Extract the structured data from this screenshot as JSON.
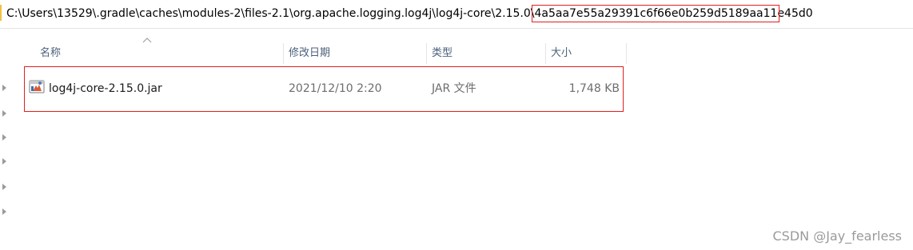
{
  "address_bar": {
    "path_prefix": "C:\\Users\\13529\\.gradle\\caches\\modules-2\\files-2.1\\org.apache.logging.log4j\\log4j-core\\2.15.0\\",
    "path_hash_highlighted": "4a5aa7e55a29391c6f66e0b259d5189aa11",
    "path_hash_rest": "e45d0"
  },
  "columns": {
    "name": "名称",
    "modified": "修改日期",
    "type": "类型",
    "size": "大小"
  },
  "files": [
    {
      "name": "log4j-core-2.15.0.jar",
      "modified": "2021/12/10 2:20",
      "type": "JAR 文件",
      "size": "1,748 KB",
      "icon": "jar-file-icon"
    }
  ],
  "watermark": "CSDN @Jay_fearless",
  "colors": {
    "highlight_border": "#e02020",
    "header_text": "#4c607a",
    "secondary_text": "#6d6d6d"
  }
}
